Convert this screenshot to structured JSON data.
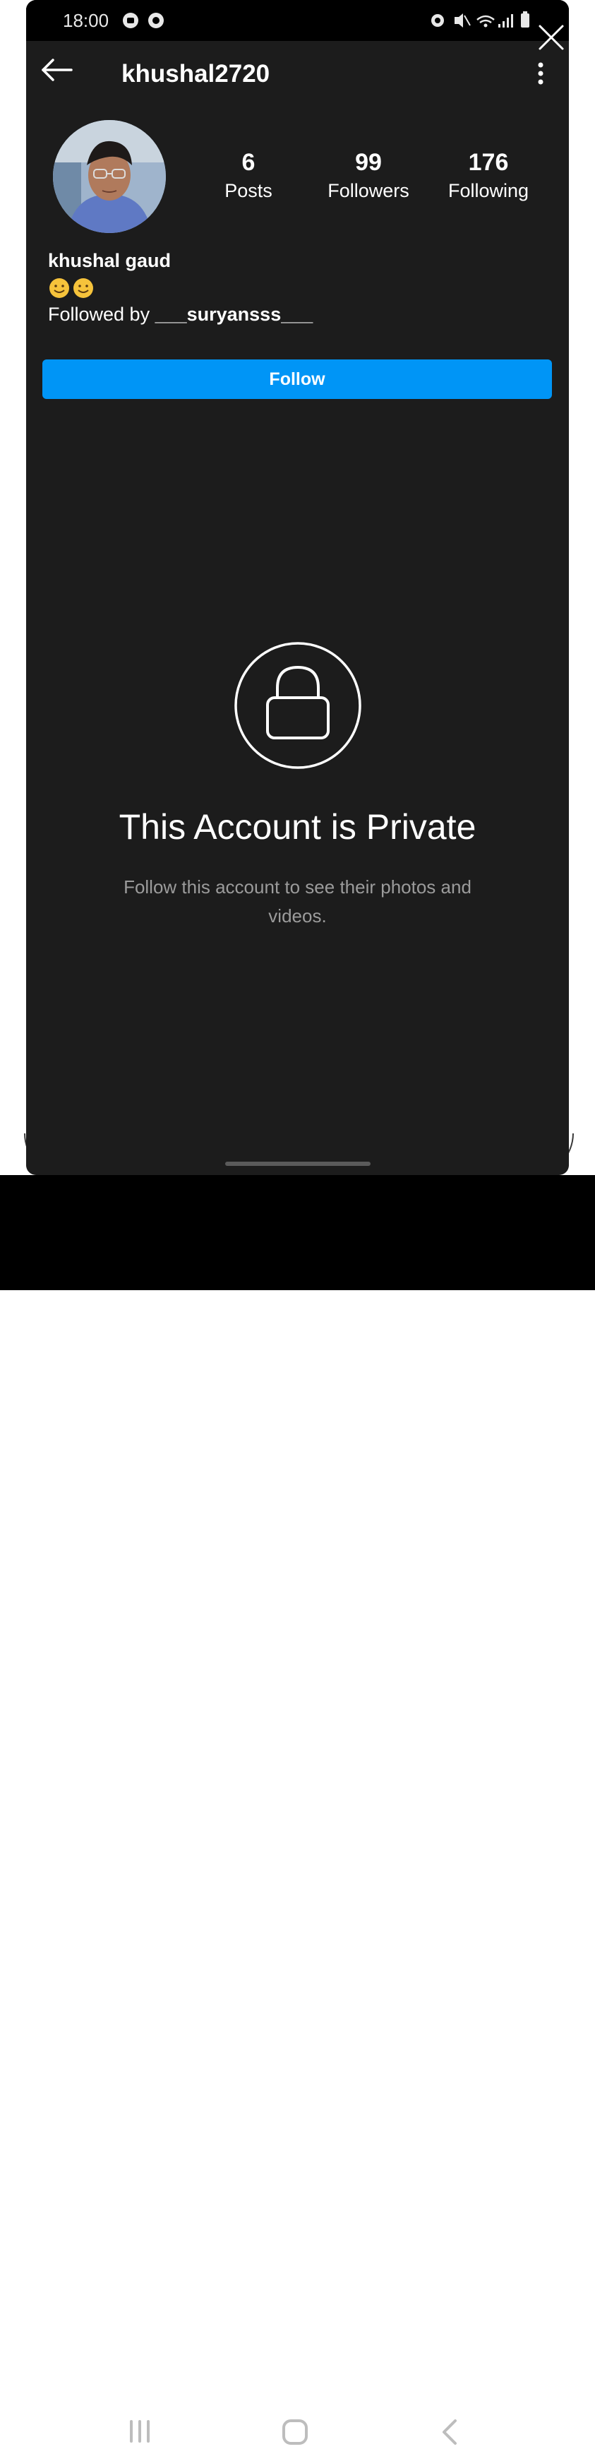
{
  "status_bar": {
    "time": "18:00"
  },
  "header": {
    "username": "khushal2720"
  },
  "stats": [
    {
      "value": "6",
      "label": "Posts"
    },
    {
      "value": "99",
      "label": "Followers"
    },
    {
      "value": "176",
      "label": "Following"
    }
  ],
  "bio": {
    "full_name": "khushal gaud",
    "emoji": "🙂🙂",
    "followed_by_prefix": "Followed by ",
    "followed_by_user": "___suryansss___"
  },
  "follow_button": {
    "label": "Follow"
  },
  "private_notice": {
    "title": "This Account is Private",
    "subtitle": "Follow this account to see their photos and videos."
  },
  "colors": {
    "background": "#1c1c1c",
    "follow_button": "#0095f6",
    "text_primary": "#ffffff",
    "text_secondary": "#9b9b9b"
  }
}
